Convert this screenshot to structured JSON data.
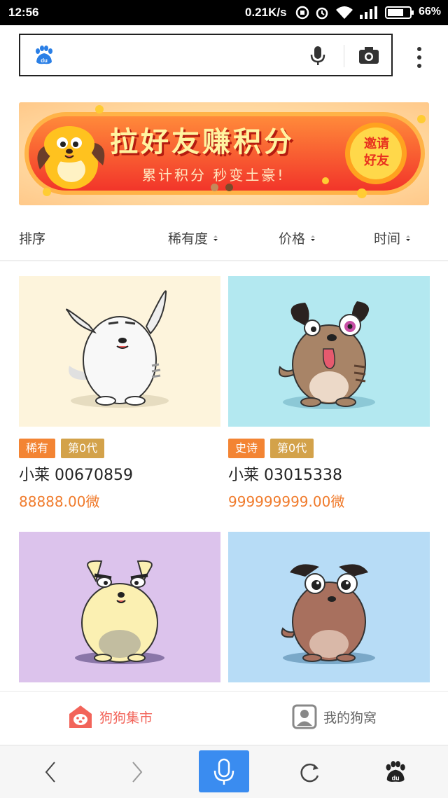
{
  "status_bar": {
    "time": "12:56",
    "net_speed": "0.21K/s",
    "battery_percent": "66%"
  },
  "search": {
    "placeholder": ""
  },
  "banner": {
    "headline": "拉好友赚积分",
    "subline": "累计积分 秒变土豪!",
    "cta_line1": "邀请",
    "cta_line2": "好友",
    "page_count": 2,
    "active_page": 1
  },
  "sort": {
    "label": "排序",
    "options": [
      "稀有度",
      "价格",
      "时间"
    ]
  },
  "cards": [
    {
      "tag1": "稀有",
      "tag2": "第0代",
      "name": "小莱 00670859",
      "price": "88888.00微",
      "bg": "#fdf4dc",
      "body_color": "#f7f7f7"
    },
    {
      "tag1": "史诗",
      "tag2": "第0代",
      "name": "小莱 03015338",
      "price": "999999999.00微",
      "bg": "#b3e8f0",
      "body_color": "#a88467"
    },
    {
      "tag1": "",
      "tag2": "",
      "name": "",
      "price": "",
      "bg": "#dcc3ec",
      "body_color": "#fbf0b2"
    },
    {
      "tag1": "",
      "tag2": "",
      "name": "",
      "price": "",
      "bg": "#b7dcf6",
      "body_color": "#a8705e"
    }
  ],
  "colors": {
    "tag_rarity": "#f38433",
    "tag_generation": "#d3a24a",
    "price": "#f07b2c",
    "active_tab": "#f2645a",
    "inactive_tab": "#666666",
    "mic_button": "#3a8cf0"
  },
  "tabs": [
    {
      "label": "狗狗集市",
      "icon": "dog-house-icon",
      "active": true
    },
    {
      "label": "我的狗窝",
      "icon": "user-card-icon",
      "active": false
    }
  ],
  "browser_bar": {
    "buttons": [
      "back-icon",
      "forward-icon",
      "mic-icon",
      "refresh-icon",
      "baidu-paw-icon"
    ]
  }
}
